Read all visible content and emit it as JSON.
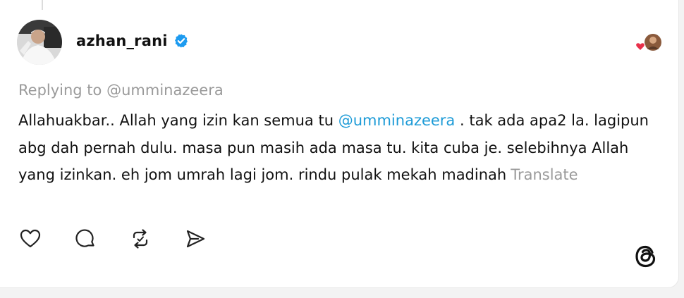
{
  "post": {
    "username": "azhan_rani",
    "verified": true,
    "reply_to_prefix": "Replying to",
    "reply_to_handle": "@umminazeera",
    "text_before": "Allahuakbar.. Allah yang izin kan semua tu ",
    "mention": "@umminazeera",
    "text_after": " . tak ada apa2 la. lagipun abg dah pernah dulu. masa pun masih ada masa tu. kita cuba je. selebihnya Allah yang izinkan. eh jom umrah lagi jom. rindu pulak mekah madinah",
    "translate_label": "Translate"
  },
  "icons": {
    "verified": "verified-badge-icon",
    "like": "heart-icon",
    "reply": "comment-bubble-icon",
    "repost": "repost-icon",
    "share": "send-icon",
    "brand": "threads-logo-icon"
  },
  "colors": {
    "mention": "#1d9bd7",
    "verified": "#1d9bf0",
    "muted_text": "#9a9a9a",
    "like_heart": "#e8304a"
  }
}
